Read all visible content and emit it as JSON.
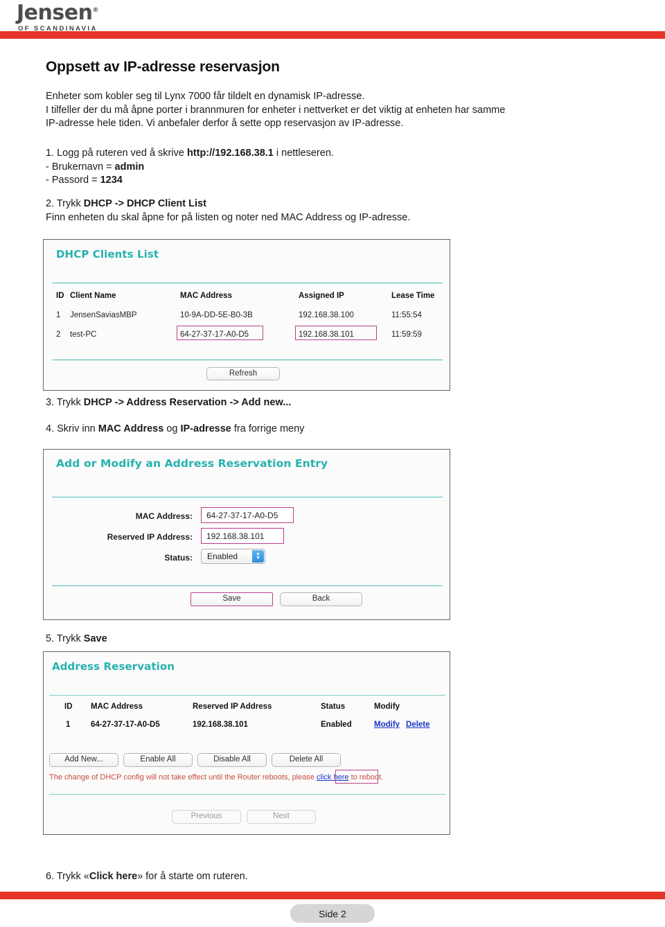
{
  "header": {
    "logo_word": "Jensen",
    "logo_reg": "®",
    "logo_sub": "OF SCANDINAVIA"
  },
  "document": {
    "title": "Oppsett av IP-adresse reservasjon",
    "intro_line1": "Enheter som kobler seg til Lynx 7000 får tildelt en dynamisk IP-adresse.",
    "intro_line2": "I tilfeller der du må åpne porter i brannmuren for enheter i nettverket er det viktig at enheten har samme",
    "intro_line3": "IP-adresse hele tiden. Vi anbefaler derfor å sette opp reservasjon av IP-adresse.",
    "step1_prefix": "1. Logg på ruteren ved å skrive ",
    "step1_url": "http://192.168.38.1",
    "step1_suffix": " i nettleseren.",
    "step1_user_label": "- Brukernavn = ",
    "step1_user_value": "admin",
    "step1_pass_label": "- Passord = ",
    "step1_pass_value": "1234",
    "step2_prefix": "2. Trykk ",
    "step2_bold": "DHCP -> DHCP Client List",
    "step2_line2": "Finn enheten du skal åpne for på listen og noter ned MAC Address og IP-adresse.",
    "step3_prefix": "3. Trykk ",
    "step3_bold": "DHCP -> Address Reservation -> Add new...",
    "step4_prefix": "4. Skriv inn ",
    "step4_bold1": "MAC Address",
    "step4_mid": " og ",
    "step4_bold2": "IP-adresse",
    "step4_suffix": " fra forrige meny",
    "step5_prefix": "5. Trykk ",
    "step5_bold": "Save",
    "step6_prefix": "6. Trykk «",
    "step6_bold": "Click here",
    "step6_suffix": "» for å starte om ruteren."
  },
  "dhcp_clients_panel": {
    "title": "DHCP Clients List",
    "columns": [
      "ID",
      "Client Name",
      "MAC Address",
      "Assigned IP",
      "Lease Time"
    ],
    "rows": [
      {
        "id": "1",
        "client_name": "JensenSaviasMBP",
        "mac": "10-9A-DD-5E-B0-3B",
        "ip": "192.168.38.100",
        "lease": "11:55:54"
      },
      {
        "id": "2",
        "client_name": "test-PC",
        "mac": "64-27-37-17-A0-D5",
        "ip": "192.168.38.101",
        "lease": "11:59:59"
      }
    ],
    "refresh_button": "Refresh"
  },
  "add_modify_panel": {
    "title": "Add or Modify an Address Reservation Entry",
    "mac_label": "MAC Address:",
    "mac_value": "64-27-37-17-A0-D5",
    "ip_label": "Reserved IP Address:",
    "ip_value": "192.168.38.101",
    "status_label": "Status:",
    "status_value": "Enabled",
    "save_button": "Save",
    "back_button": "Back"
  },
  "address_reservation_panel": {
    "title": "Address Reservation",
    "columns": [
      "ID",
      "MAC Address",
      "Reserved IP Address",
      "Status",
      "Modify"
    ],
    "rows": [
      {
        "id": "1",
        "mac": "64-27-37-17-A0-D5",
        "ip": "192.168.38.101",
        "status": "Enabled",
        "modify_link": "Modify",
        "delete_link": "Delete"
      }
    ],
    "buttons": [
      "Add New...",
      "Enable All",
      "Disable All",
      "Delete All"
    ],
    "warning_before": "The change of DHCP config will not take effect until the Router reboots, please ",
    "warning_link": "click here",
    "warning_after": " to reboot.",
    "previous_button": "Previous",
    "next_button": "Next"
  },
  "footer": {
    "page_label": "Side 2"
  },
  "colors": {
    "brand_red": "#e8352b",
    "router_teal": "#26b2ae",
    "highlight_pink": "#bb4089",
    "link_blue": "#1a34c8",
    "warning_red": "#c44c40"
  }
}
